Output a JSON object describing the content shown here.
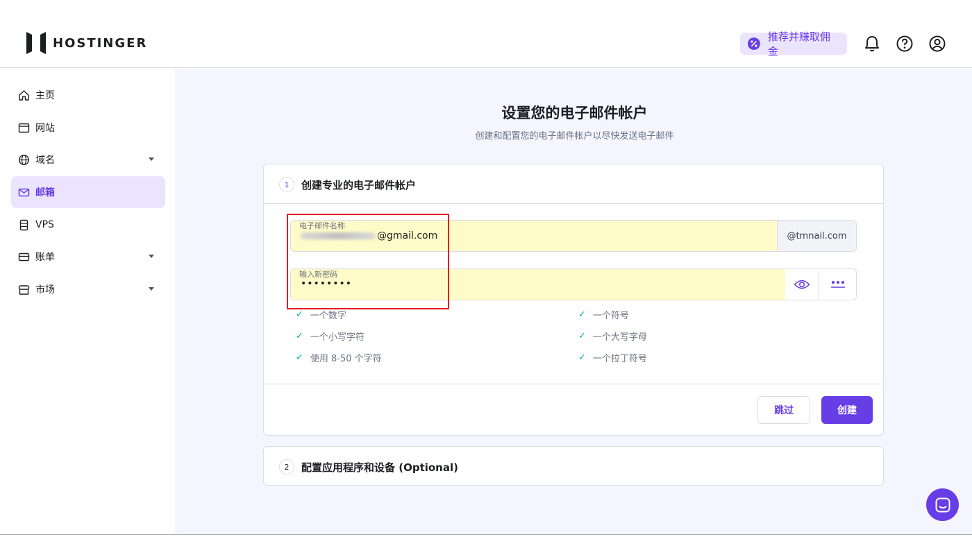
{
  "header": {
    "brand": "HOSTINGER",
    "referral_label": "推荐并赚取佣金"
  },
  "sidebar": {
    "items": [
      {
        "label": "主页",
        "icon": "home-icon",
        "active": false,
        "has_caret": false
      },
      {
        "label": "网站",
        "icon": "window-icon",
        "active": false,
        "has_caret": false
      },
      {
        "label": "域名",
        "icon": "globe-icon",
        "active": false,
        "has_caret": true
      },
      {
        "label": "邮箱",
        "icon": "mail-icon",
        "active": true,
        "has_caret": false
      },
      {
        "label": "VPS",
        "icon": "server-icon",
        "active": false,
        "has_caret": false
      },
      {
        "label": "账单",
        "icon": "card-icon",
        "active": false,
        "has_caret": true
      },
      {
        "label": "市场",
        "icon": "store-icon",
        "active": false,
        "has_caret": true
      }
    ]
  },
  "main": {
    "title": "设置您的电子邮件帐户",
    "subtitle": "创建和配置您的电子邮件帐户以尽快发送电子邮件",
    "step1": {
      "number": "1",
      "title": "创建专业的电子邮件帐户",
      "email_field": {
        "label": "电子邮件名称",
        "value_visible": "@gmail.com",
        "suffix": "@tmnail.com"
      },
      "password_field": {
        "label": "输入新密码",
        "value": "••••••••"
      },
      "requirements_left": [
        "一个数字",
        "一个小写字符",
        "使用 8-50 个字符"
      ],
      "requirements_right": [
        "一个符号",
        "一个大写字母",
        "一个拉丁符号"
      ],
      "skip_label": "跳过",
      "create_label": "创建"
    },
    "step2": {
      "number": "2",
      "title": "配置应用程序和设备 (Optional)"
    }
  },
  "colors": {
    "accent": "#673de6",
    "accent_light": "#ebe4ff",
    "field_fill": "#fefbc8",
    "check": "#00b090",
    "highlight": "#e21b22"
  }
}
